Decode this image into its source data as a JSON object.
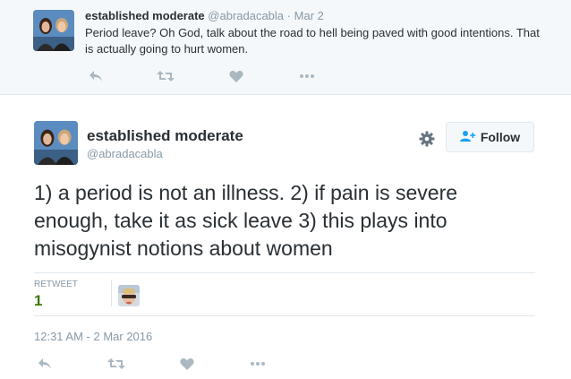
{
  "colors": {
    "parent_background": "#f5f8fa",
    "text": "#292f33",
    "muted": "#8899a6",
    "icon": "#aab8c2",
    "follow_accent": "#1da1f2",
    "retweet_count": "#3b7a08",
    "border": "#e1e8ed"
  },
  "parent_tweet": {
    "name": "established moderate",
    "handle": "@abradacabla",
    "separator": "·",
    "time": "Mar 2",
    "text": "Period leave? Oh God, talk about the road to hell being paved with good intentions. That is actually going to hurt women.",
    "actions": [
      "reply-icon",
      "retweet-icon",
      "like-icon",
      "more-icon"
    ]
  },
  "main_tweet": {
    "name": "established moderate",
    "handle": "@abradacabla",
    "settings_icon": "gear-icon",
    "follow_label": "Follow",
    "follow_icon": "add-person-icon",
    "text": "1) a period is not an illness. 2) if pain is severe enough, take it  as sick leave 3) this plays into misogynist notions about women",
    "stats": {
      "retweet_label": "RETWEET",
      "retweet_count": "1"
    },
    "timestamp": "12:31 AM - 2 Mar 2016",
    "actions": [
      "reply-icon",
      "retweet-icon",
      "like-icon",
      "more-icon"
    ]
  }
}
